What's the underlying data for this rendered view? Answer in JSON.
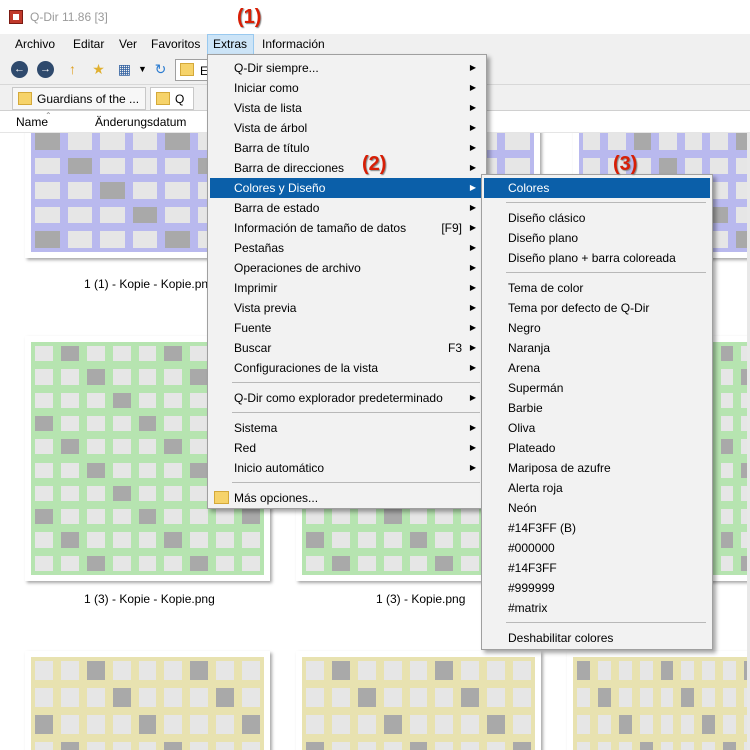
{
  "window": {
    "title": "Q-Dir 11.86 [3]"
  },
  "menubar": {
    "items": [
      {
        "label": "Archivo",
        "key": "archivo"
      },
      {
        "label": "Editar",
        "key": "editar"
      },
      {
        "label": "Ver",
        "key": "ver"
      },
      {
        "label": "Favoritos",
        "key": "favoritos"
      },
      {
        "label": "Extras",
        "key": "extras"
      },
      {
        "label": "Información",
        "key": "informacion"
      }
    ]
  },
  "toolbar": {
    "address_text": "Ex"
  },
  "tabs": [
    {
      "label": "Guardians of the ..."
    },
    {
      "label": "Q"
    }
  ],
  "columns": {
    "name": "Name",
    "date": "Änderungsdatum"
  },
  "files": [
    {
      "label": "1 (1) - Kopie - Kopie.png"
    },
    {
      "label": "1 (3) - Kopie - Kopie.png"
    },
    {
      "label": "1 (3) - Kopie.png"
    }
  ],
  "colors": {
    "accent": "#0b5fa9",
    "thumb_purple": "#b9b9ee",
    "thumb_green": "#b6e4b0",
    "thumb_yellow": "#e8e2b0",
    "tile_light": "#e6e6e6",
    "tile_dark": "#a9a9a9",
    "callout": "#d81e05"
  },
  "extras_menu": {
    "items": [
      {
        "label": "Q-Dir siempre...",
        "submenu": true
      },
      {
        "label": "Iniciar como",
        "submenu": true
      },
      {
        "label": "Vista de lista",
        "submenu": true
      },
      {
        "label": "Vista de árbol",
        "submenu": true
      },
      {
        "label": "Barra de título",
        "submenu": true
      },
      {
        "label": "Barra de direcciones",
        "submenu": true
      },
      {
        "label": "Colores y Diseño",
        "submenu": true,
        "highlight": true
      },
      {
        "label": "Barra de estado",
        "submenu": true
      },
      {
        "label": "Información de tamaño de datos",
        "shortcut": "[F9]",
        "submenu": true
      },
      {
        "label": "Pestañas",
        "submenu": true
      },
      {
        "label": "Operaciones de archivo",
        "submenu": true
      },
      {
        "label": "Imprimir",
        "submenu": true
      },
      {
        "label": "Vista previa",
        "submenu": true
      },
      {
        "label": "Fuente",
        "submenu": true
      },
      {
        "label": "Buscar",
        "shortcut": "F3",
        "submenu": true
      },
      {
        "label": "Configuraciones de la vista",
        "submenu": true
      },
      {
        "separator": true
      },
      {
        "label": "Q-Dir como explorador predeterminado",
        "submenu": true
      },
      {
        "separator": true
      },
      {
        "label": "Sistema",
        "submenu": true
      },
      {
        "label": "Red",
        "submenu": true
      },
      {
        "label": "Inicio automático",
        "submenu": true
      },
      {
        "separator": true
      },
      {
        "label": "Más opciones...",
        "icon": "folder-icon"
      }
    ]
  },
  "colors_menu": {
    "items": [
      {
        "label": "Colores",
        "highlight": true
      },
      {
        "separator": true
      },
      {
        "label": "Diseño clásico"
      },
      {
        "label": "Diseño plano"
      },
      {
        "label": "Diseño plano + barra coloreada"
      },
      {
        "separator": true
      },
      {
        "label": "Tema de color"
      },
      {
        "label": "Tema por defecto de Q-Dir"
      },
      {
        "label": "Negro"
      },
      {
        "label": "Naranja"
      },
      {
        "label": "Arena"
      },
      {
        "label": "Supermán"
      },
      {
        "label": "Barbie"
      },
      {
        "label": "Oliva"
      },
      {
        "label": "Plateado"
      },
      {
        "label": "Mariposa de azufre"
      },
      {
        "label": "Alerta roja"
      },
      {
        "label": "Neón"
      },
      {
        "label": "#14F3FF (B)"
      },
      {
        "label": "#000000"
      },
      {
        "label": "#14F3FF"
      },
      {
        "label": "#999999"
      },
      {
        "label": "#matrix"
      },
      {
        "separator": true
      },
      {
        "label": "Deshabilitar colores"
      }
    ]
  },
  "callouts": [
    "(1)",
    "(2)",
    "(3)"
  ]
}
